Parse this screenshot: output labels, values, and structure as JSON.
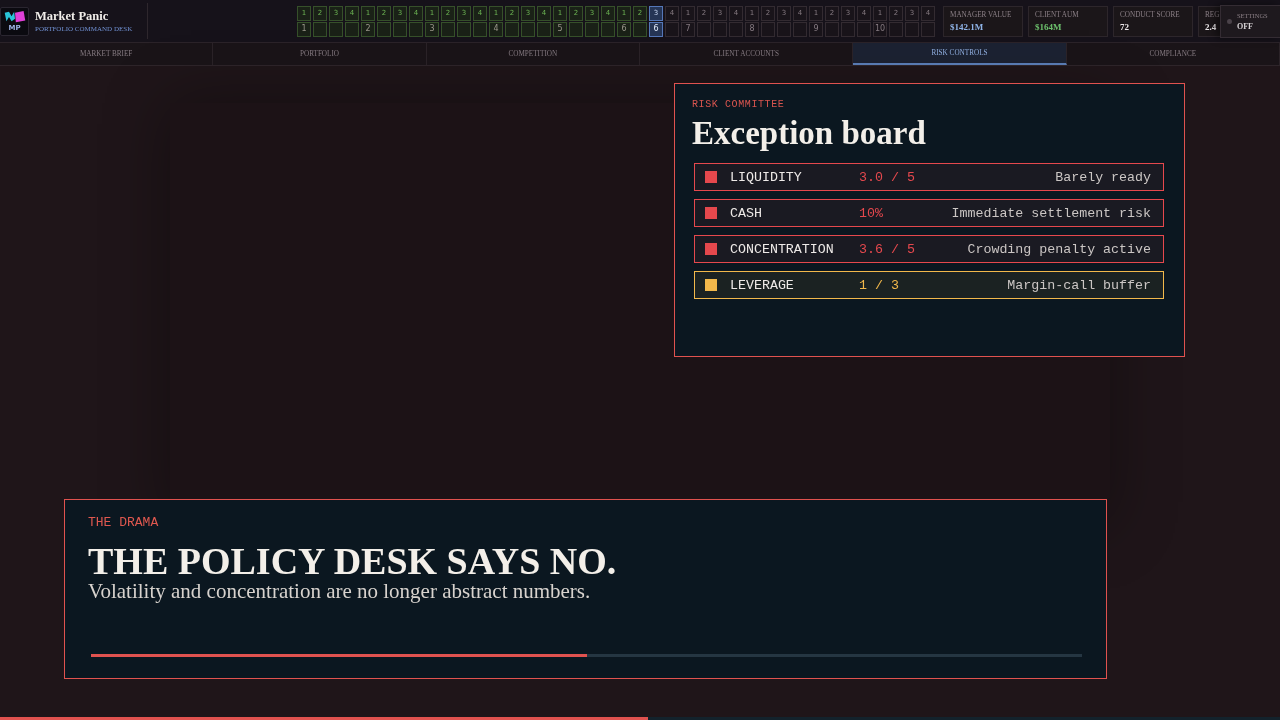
{
  "app": {
    "logo_text": "MP",
    "title": "Market Panic",
    "subtitle": "PORTFOLIO COMMAND DESK"
  },
  "timeline": [
    {
      "week": "1",
      "month": "1",
      "kind": "done"
    },
    {
      "week": "2",
      "kind": "done"
    },
    {
      "week": "3",
      "kind": "done"
    },
    {
      "week": "4",
      "kind": "done"
    },
    {
      "week": "1",
      "month": "2",
      "kind": "done"
    },
    {
      "week": "2",
      "kind": "done"
    },
    {
      "week": "3",
      "kind": "done"
    },
    {
      "week": "4",
      "kind": "done"
    },
    {
      "week": "1",
      "month": "3",
      "kind": "done"
    },
    {
      "week": "2",
      "kind": "done"
    },
    {
      "week": "3",
      "kind": "done"
    },
    {
      "week": "4",
      "kind": "done"
    },
    {
      "week": "1",
      "month": "4",
      "kind": "done"
    },
    {
      "week": "2",
      "kind": "done"
    },
    {
      "week": "3",
      "kind": "done"
    },
    {
      "week": "4",
      "kind": "done"
    },
    {
      "week": "1",
      "month": "5",
      "kind": "done"
    },
    {
      "week": "2",
      "kind": "done"
    },
    {
      "week": "3",
      "kind": "done"
    },
    {
      "week": "4",
      "kind": "done"
    },
    {
      "week": "1",
      "month": "6",
      "kind": "done"
    },
    {
      "week": "2",
      "kind": "done"
    },
    {
      "week": "3",
      "month": "6",
      "kind": "current"
    },
    {
      "week": "4",
      "kind": "future"
    },
    {
      "week": "1",
      "month": "7",
      "kind": "future"
    },
    {
      "week": "2",
      "kind": "future"
    },
    {
      "week": "3",
      "kind": "future"
    },
    {
      "week": "4",
      "kind": "future"
    },
    {
      "week": "1",
      "month": "8",
      "kind": "future"
    },
    {
      "week": "2",
      "kind": "future"
    },
    {
      "week": "3",
      "kind": "future"
    },
    {
      "week": "4",
      "kind": "future"
    },
    {
      "week": "1",
      "month": "9",
      "kind": "future"
    },
    {
      "week": "2",
      "kind": "future"
    },
    {
      "week": "3",
      "kind": "future"
    },
    {
      "week": "4",
      "kind": "future"
    },
    {
      "week": "1",
      "month": "10",
      "kind": "future"
    },
    {
      "week": "2",
      "kind": "future"
    },
    {
      "week": "3",
      "kind": "future"
    },
    {
      "week": "4",
      "kind": "future"
    }
  ],
  "stats": [
    {
      "label": "MANAGER VALUE",
      "value": "$142.1M",
      "color": "#8fb4e8"
    },
    {
      "label": "CLIENT AUM",
      "value": "$164M",
      "color": "#6cc06c"
    },
    {
      "label": "CONDUCT SCORE",
      "value": "72",
      "color": "#ece8ea"
    },
    {
      "label": "REG",
      "value": "2.4",
      "color": "#ece8ea"
    }
  ],
  "settings": {
    "label": "SETTINGS",
    "value": "OFF",
    "on": false
  },
  "tabs": [
    {
      "label": "MARKET BRIEF",
      "selected": false
    },
    {
      "label": "PORTFOLIO",
      "selected": false
    },
    {
      "label": "COMPETITION",
      "selected": false
    },
    {
      "label": "CLIENT ACCOUNTS",
      "selected": false
    },
    {
      "label": "RISK CONTROLS",
      "selected": true
    },
    {
      "label": "COMPLIANCE",
      "selected": false
    }
  ],
  "risk_panel": {
    "eyebrow": "RISK COMMITTEE",
    "title": "Exception board",
    "rows": [
      {
        "name": "LIQUIDITY",
        "value": "3.0 / 5",
        "note": "Barely ready",
        "color": "#e5484d"
      },
      {
        "name": "CASH",
        "value": "10%",
        "note": "Immediate settlement risk",
        "color": "#e5484d"
      },
      {
        "name": "CONCENTRATION",
        "value": "3.6 / 5",
        "note": "Crowding penalty active",
        "color": "#e5484d"
      },
      {
        "name": "LEVERAGE",
        "value": "1 / 3",
        "note": "Margin-call buffer",
        "color": "#f2b84b"
      }
    ]
  },
  "drama": {
    "eyebrow": "THE DRAMA",
    "headline": "THE POLICY DESK SAYS NO.",
    "subtitle": "Volatility and concentration are no longer abstract numbers.",
    "level": 0.5
  },
  "footer_progress": {
    "level": 0.506
  }
}
